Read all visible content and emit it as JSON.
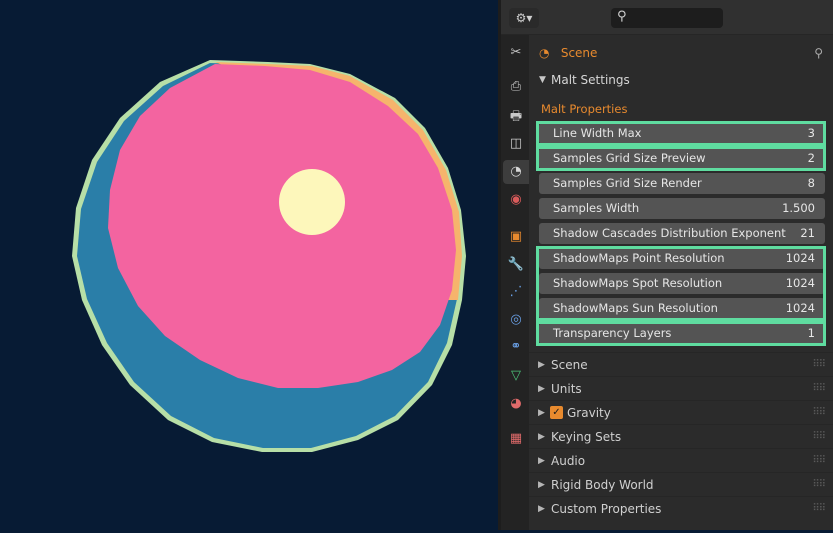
{
  "header": {
    "editor_type_icon": "properties-editor-icon",
    "editor_type_glyph": "⚙▾",
    "search_icon": "search-icon",
    "search_glyph": "⚲"
  },
  "tabs": [
    {
      "icon": "tool-icon",
      "glyph": "✂",
      "color": "#c9c9c9"
    },
    {
      "icon": "render-icon",
      "glyph": "⎙",
      "color": "#c9c9c9"
    },
    {
      "icon": "output-icon",
      "glyph": "🖶",
      "color": "#c9c9c9"
    },
    {
      "icon": "view-layer-icon",
      "glyph": "◫",
      "color": "#c9c9c9"
    },
    {
      "icon": "scene-icon",
      "glyph": "◔",
      "color": "#d7d7d7",
      "active": true
    },
    {
      "icon": "world-icon",
      "glyph": "◉",
      "color": "#d95b5b"
    },
    {
      "icon": "object-icon",
      "glyph": "▣",
      "color": "#e88a2e"
    },
    {
      "icon": "modifier-icon",
      "glyph": "🔧",
      "color": "#6aa0e6"
    },
    {
      "icon": "particles-icon",
      "glyph": "⋰",
      "color": "#6aa0e6"
    },
    {
      "icon": "physics-icon",
      "glyph": "◎",
      "color": "#6aa0e6"
    },
    {
      "icon": "constraints-icon",
      "glyph": "⚭",
      "color": "#6aa0e6"
    },
    {
      "icon": "data-icon",
      "glyph": "▽",
      "color": "#4cc37a"
    },
    {
      "icon": "material-icon",
      "glyph": "◕",
      "color": "#e06a6a"
    },
    {
      "icon": "texture-icon",
      "glyph": "▦",
      "color": "#e06a6a"
    }
  ],
  "breadcrumb": {
    "label": "Scene",
    "icon": "scene-icon",
    "glyph": "◔"
  },
  "pin_glyph": "⚲",
  "malt_settings": {
    "title": "Malt Settings",
    "group_label": "Malt Properties",
    "properties": [
      {
        "name": "Line Width Max",
        "value": "3"
      },
      {
        "name": "Samples Grid Size Preview",
        "value": "2"
      },
      {
        "name": "Samples Grid Size Render",
        "value": "8"
      },
      {
        "name": "Samples Width",
        "value": "1.500"
      },
      {
        "name": "Shadow Cascades Distribution Exponent",
        "value": "21"
      },
      {
        "name": "ShadowMaps Point Resolution",
        "value": "1024"
      },
      {
        "name": "ShadowMaps Spot Resolution",
        "value": "1024"
      },
      {
        "name": "ShadowMaps Sun Resolution",
        "value": "1024"
      },
      {
        "name": "Transparency Layers",
        "value": "1"
      }
    ]
  },
  "subpanels": [
    {
      "label": "Scene"
    },
    {
      "label": "Units"
    },
    {
      "label": "Gravity",
      "checkbox": true,
      "checked": true
    },
    {
      "label": "Keying Sets"
    },
    {
      "label": "Audio"
    },
    {
      "label": "Rigid Body World"
    },
    {
      "label": "Custom Properties"
    }
  ],
  "viewport": {
    "background": "#071b34",
    "sphere_colors": {
      "outline": "#b7dfa7",
      "blue": "#2a7ea8",
      "pink": "#f364a0",
      "orange": "#f6b46c",
      "highlight": "#fdf7bb"
    }
  },
  "highlight_color": "#5fdca0"
}
